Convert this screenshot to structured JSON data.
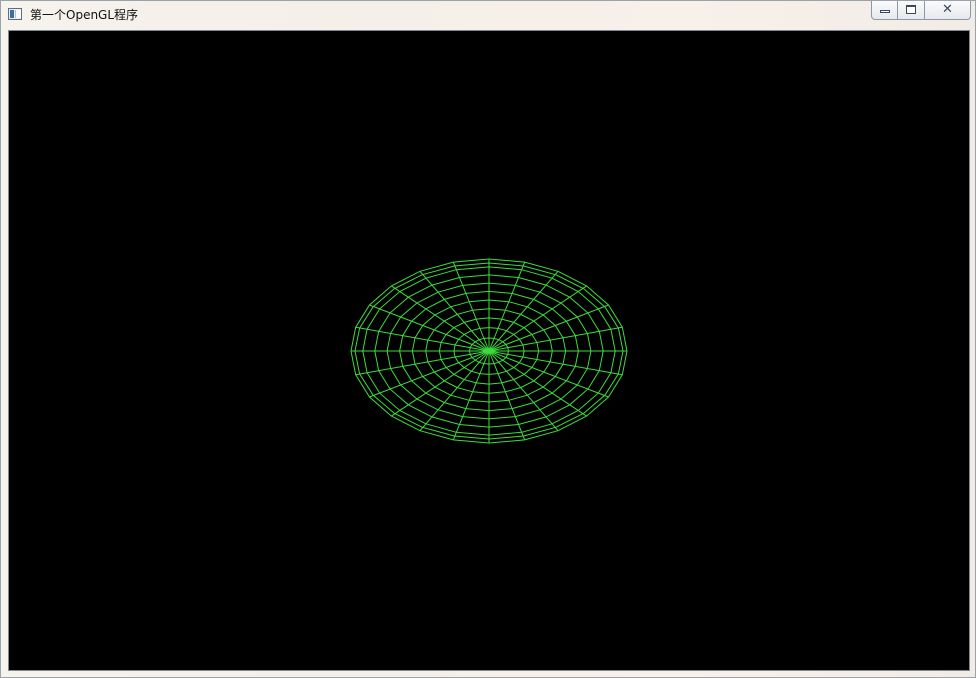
{
  "window": {
    "title": "第一个OpenGL程序",
    "icon": "app-window-icon",
    "buttons": {
      "minimize": "minimize-icon",
      "maximize": "maximize-icon",
      "close_glyph": "✕"
    }
  },
  "scene": {
    "background_color": "#000000",
    "wireframe_color": "#3ddc3d",
    "object": "wireframe-disc",
    "rings": 10,
    "spokes": 24
  }
}
